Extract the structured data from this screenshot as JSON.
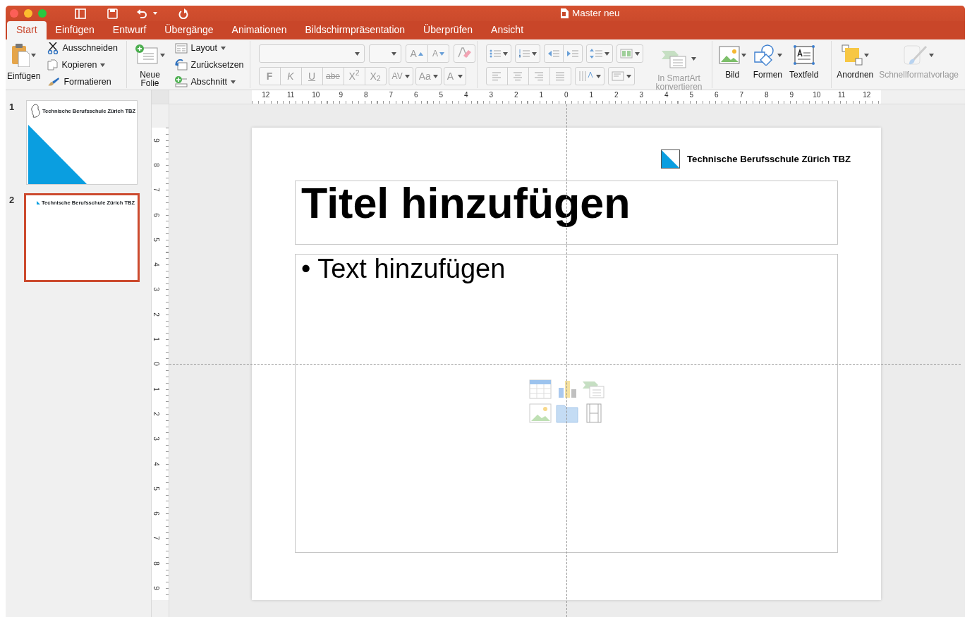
{
  "window": {
    "title": "Master neu"
  },
  "tabs": [
    {
      "label": "Start",
      "selected": true
    },
    {
      "label": "Einfügen",
      "selected": false
    },
    {
      "label": "Entwurf",
      "selected": false
    },
    {
      "label": "Übergänge",
      "selected": false
    },
    {
      "label": "Animationen",
      "selected": false
    },
    {
      "label": "Bildschirmpräsentation",
      "selected": false
    },
    {
      "label": "Überprüfen",
      "selected": false
    },
    {
      "label": "Ansicht",
      "selected": false
    }
  ],
  "ribbon": {
    "paste": {
      "label": "Einfügen",
      "menu": true
    },
    "clipboard_items": [
      {
        "label": "Ausschneiden",
        "menu": false
      },
      {
        "label": "Kopieren",
        "menu": true
      },
      {
        "label": "Formatieren",
        "menu": false
      }
    ],
    "new_slide": {
      "label": "Neue Folie",
      "menu": true
    },
    "slide_items": [
      {
        "label": "Layout",
        "menu": true
      },
      {
        "label": "Zurücksetzen",
        "menu": false
      },
      {
        "label": "Abschnitt",
        "menu": true
      }
    ],
    "font": {
      "disabled": true,
      "grow": "A",
      "shrink": "A",
      "styles": [
        "F",
        "K",
        "U",
        "abe",
        "X$^{2}$",
        "X$_{2}$"
      ],
      "spacing": "AV",
      "case": "Aa",
      "font_color_label": "A"
    },
    "paragraph": {
      "disabled": true
    },
    "big_buttons": [
      {
        "kind": "smartart",
        "label": "In SmartArt konvertieren",
        "menu": true,
        "disabled": true
      },
      {
        "kind": "picture",
        "label": "Bild",
        "menu": true,
        "disabled": false
      },
      {
        "kind": "shapes",
        "label": "Formen",
        "menu": true,
        "disabled": false
      },
      {
        "kind": "textbox",
        "label": "Textfeld",
        "menu": false,
        "disabled": false
      },
      {
        "kind": "arrange",
        "label": "Anordnen",
        "menu": true,
        "disabled": false
      },
      {
        "kind": "quickstyle",
        "label": "Schnellformatvorlage",
        "menu": true,
        "disabled": true
      }
    ]
  },
  "thumbnails": [
    {
      "number": "1",
      "kind": "title",
      "caption": "Technische Berufsschule Zürich TBZ",
      "selected": false
    },
    {
      "number": "2",
      "kind": "content",
      "caption": "Technische Berufsschule Zürich TBZ",
      "selected": true
    }
  ],
  "rulers": {
    "horizontal": [
      "12",
      "11",
      "10",
      "9",
      "8",
      "7",
      "6",
      "5",
      "4",
      "3",
      "2",
      "1",
      "0",
      "1",
      "2",
      "3",
      "4",
      "5",
      "6",
      "7",
      "8",
      "9",
      "10",
      "11",
      "12"
    ],
    "vertical": [
      "9",
      "8",
      "7",
      "6",
      "5",
      "4",
      "3",
      "2",
      "1",
      "0",
      "1",
      "2",
      "3",
      "4",
      "5",
      "6",
      "7",
      "8",
      "9"
    ]
  },
  "slide": {
    "logo_text": "Technische Berufsschule Zürich TBZ",
    "title_placeholder": "Titel hinzufügen",
    "body_placeholder": "• Text hinzufügen"
  }
}
